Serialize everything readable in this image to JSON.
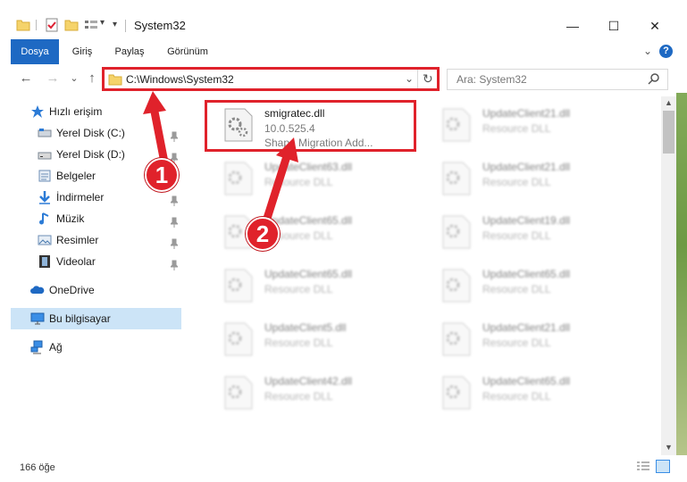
{
  "window": {
    "title": "System32",
    "minimize_glyph": "—",
    "maximize_glyph": "☐",
    "close_glyph": "✕",
    "help_glyph": "?"
  },
  "ribbon": {
    "tabs": [
      "Dosya",
      "Giriş",
      "Paylaş",
      "Görünüm"
    ],
    "active_color": "#1e69c3",
    "expand_glyph": "⌄"
  },
  "nav": {
    "back_glyph": "←",
    "forward_glyph": "→",
    "recent_glyph": "⌄",
    "up_glyph": "↑",
    "address": "C:\\Windows\\System32",
    "refresh_glyph": "↻",
    "dropdown_glyph": "⌄",
    "search_placeholder": "Ara: System32"
  },
  "sidebar": {
    "items": [
      {
        "label": "Hızlı erişim",
        "icon": "star-icon",
        "pinned": false
      },
      {
        "label": "Yerel Disk (C:)",
        "icon": "drive-icon",
        "pinned": true
      },
      {
        "label": "Yerel Disk (D:)",
        "icon": "drive-icon",
        "pinned": true
      },
      {
        "label": "Belgeler",
        "icon": "documents-icon",
        "pinned": true
      },
      {
        "label": "İndirmeler",
        "icon": "download-icon",
        "pinned": true
      },
      {
        "label": "Müzik",
        "icon": "music-icon",
        "pinned": true
      },
      {
        "label": "Resimler",
        "icon": "pictures-icon",
        "pinned": true
      },
      {
        "label": "Videolar",
        "icon": "video-icon",
        "pinned": true
      },
      {
        "label": "OneDrive",
        "icon": "cloud-icon",
        "pinned": false
      },
      {
        "label": "Bu bilgisayar",
        "icon": "computer-icon",
        "pinned": false
      },
      {
        "label": "Ağ",
        "icon": "network-icon",
        "pinned": false
      }
    ]
  },
  "files": [
    {
      "name": "smigratec.dll",
      "line2": "10.0.525.4",
      "line3": "Shape Migration Add..."
    },
    {
      "name": "UpdateClient21.dll",
      "line2": "Resource DLL"
    },
    {
      "name": "UpdateClient63.dll",
      "line2": "Resource DLL"
    },
    {
      "name": "UpdateClient21.dll",
      "line2": "Resource DLL"
    },
    {
      "name": "UpdateClient65.dll",
      "line2": "Resource DLL"
    },
    {
      "name": "UpdateClient19.dll",
      "line2": "Resource DLL"
    },
    {
      "name": "UpdateClient65.dll",
      "line2": "Resource DLL"
    },
    {
      "name": "UpdateClient65.dll",
      "line2": "Resource DLL"
    },
    {
      "name": "UpdateClient5.dll",
      "line2": "Resource DLL"
    },
    {
      "name": "UpdateClient21.dll",
      "line2": "Resource DLL"
    },
    {
      "name": "UpdateClient42.dll",
      "line2": "Resource DLL"
    },
    {
      "name": "UpdateClient65.dll",
      "line2": "Resource DLL"
    }
  ],
  "status": {
    "count": "166 öğe"
  },
  "annotations": {
    "badge1": "1",
    "badge2": "2",
    "color": "#e0222b"
  }
}
